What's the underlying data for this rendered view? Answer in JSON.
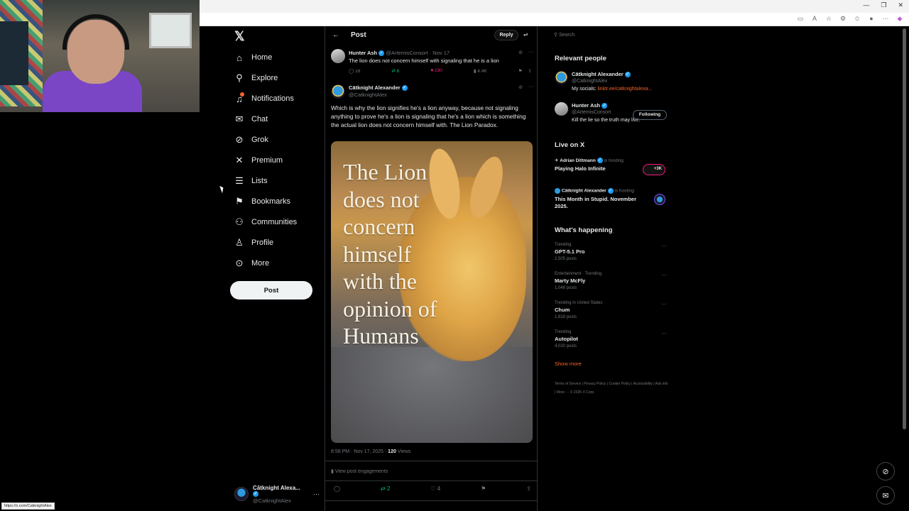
{
  "browser": {
    "window_controls": [
      "—",
      "❐",
      "✕"
    ],
    "status_url": "https://x.com/CatknightAlex"
  },
  "nav": {
    "items": [
      {
        "label": "Home",
        "icon": "home-icon"
      },
      {
        "label": "Explore",
        "icon": "search-icon"
      },
      {
        "label": "Notifications",
        "icon": "bell-icon"
      },
      {
        "label": "Chat",
        "icon": "mail-icon"
      },
      {
        "label": "Grok",
        "icon": "grok-icon"
      },
      {
        "label": "Premium",
        "icon": "x-icon"
      },
      {
        "label": "Lists",
        "icon": "list-icon"
      },
      {
        "label": "Bookmarks",
        "icon": "bookmark-icon"
      },
      {
        "label": "Communities",
        "icon": "communities-icon"
      },
      {
        "label": "Profile",
        "icon": "person-icon"
      },
      {
        "label": "More",
        "icon": "more-circle-icon"
      }
    ],
    "post_label": "Post",
    "account": {
      "name": "Cātknight Alexa...",
      "handle": "@CatknightAlex"
    }
  },
  "main": {
    "title": "Post",
    "reply_label": "Reply",
    "parent": {
      "name": "Hunter Ash",
      "handle": "@ArtemisConsort",
      "date": "· Nov 17",
      "text": "The lion does not concern himself with signaling that he is a lion",
      "replies": "16",
      "reposts": "6",
      "likes": "190",
      "views": "4.4K"
    },
    "tweet": {
      "name": "Cātknight Alexander",
      "handle": "@CatknightAlex",
      "text": "Which is why the lion signifies he's a lion anyway, because not signaling anything to prove he's a lion is signaling that he's a lion which is something the actual lion does not concern himself with. The Lion Paradox.",
      "image_caption": "The Lion does not concern himself with the opinion of Humans",
      "time": "8:58 PM · Nov 17, 2025 ·",
      "views_count": "120",
      "views_label": "Views",
      "engagements_label": "View post engagements",
      "reposts": "2",
      "likes": "4"
    }
  },
  "right": {
    "search_placeholder": "Search",
    "relevant_title": "Relevant people",
    "people": [
      {
        "name": "Cātknight Alexander",
        "handle": "@CatknightAlex",
        "bio": "My socials: ",
        "link": "linktr.ee/catknightalexa..."
      },
      {
        "name": "Hunter Ash",
        "handle": "@ArtemisConsort",
        "bio": "Kill the lie so the truth may live.",
        "follow_label": "Following"
      }
    ],
    "live_title": "Live on X",
    "live": [
      {
        "host": "Adrian Dittmann",
        "suffix": " is hosting",
        "title": "Playing Halo Infinite",
        "badge": "+3K"
      },
      {
        "host": "Cātknight Alexander",
        "suffix": " is hosting",
        "title": "This Month in Stupid. November 2025."
      }
    ],
    "happening_title": "What's happening",
    "trends": [
      {
        "category": "Trending",
        "name": "GPT-5.1 Pro",
        "count": "2,505 posts"
      },
      {
        "category": "Entertainment · Trending",
        "name": "Marty McFly",
        "count": "1,048 posts"
      },
      {
        "category": "Trending in United States",
        "name": "Chum",
        "count": "1,818 posts"
      },
      {
        "category": "Trending",
        "name": "Autopilot",
        "count": "4,020 posts"
      }
    ],
    "show_more": "Show more",
    "footer": "Terms of Service | Privacy Policy | Cookie Policy | Accessibility | Ads info | More ··· © 2025 X Corp."
  },
  "colors": {
    "accent": "#f4642a",
    "verified": "#1d9bf0",
    "background": "#000000",
    "like": "#f91880",
    "repost": "#00ba7c"
  }
}
